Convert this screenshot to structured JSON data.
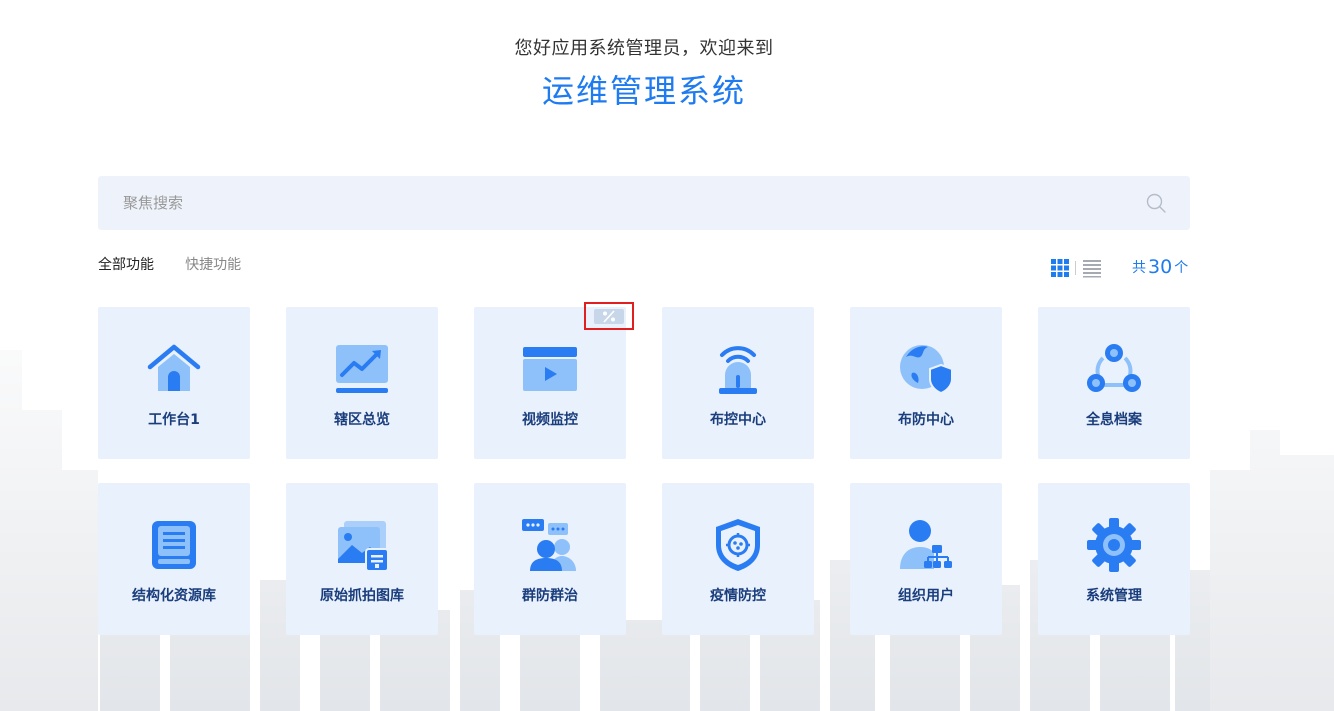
{
  "header": {
    "greeting": "您好应用系统管理员，欢迎来到",
    "system_title": "运维管理系统"
  },
  "search": {
    "placeholder": "聚焦搜索",
    "value": ""
  },
  "tabs": [
    {
      "label": "全部功能",
      "active": true
    },
    {
      "label": "快捷功能",
      "active": false
    }
  ],
  "count": {
    "prefix": "共",
    "value": "30",
    "suffix": "个"
  },
  "colors": {
    "accent": "#1e7bf0",
    "card_bg": "#e9f1fd",
    "icon_primary": "#2a7cf2",
    "icon_light": "#8ec0fa",
    "label": "#1a3d7c",
    "highlight_box": "#e02020"
  },
  "cards": [
    {
      "label": "工作台1",
      "icon": "home-icon"
    },
    {
      "label": "辖区总览",
      "icon": "trend-chart-icon"
    },
    {
      "label": "视频监控",
      "icon": "video-player-icon"
    },
    {
      "label": "布控中心",
      "icon": "alarm-beacon-icon"
    },
    {
      "label": "布防中心",
      "icon": "globe-shield-icon"
    },
    {
      "label": "全息档案",
      "icon": "network-nodes-icon"
    },
    {
      "label": "结构化资源库",
      "icon": "inbox-tray-icon"
    },
    {
      "label": "原始抓拍图库",
      "icon": "image-gallery-icon"
    },
    {
      "label": "群防群治",
      "icon": "people-chat-icon"
    },
    {
      "label": "疫情防控",
      "icon": "virus-shield-icon"
    },
    {
      "label": "组织用户",
      "icon": "user-org-icon"
    },
    {
      "label": "系统管理",
      "icon": "gear-icon"
    }
  ]
}
